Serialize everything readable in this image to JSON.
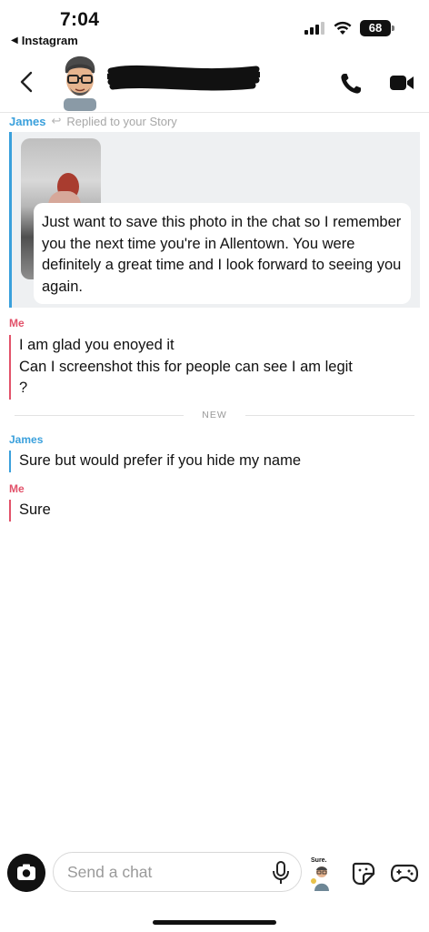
{
  "status_bar": {
    "time": "7:04",
    "back_app": "Instagram",
    "battery": "68"
  },
  "header": {
    "back": "back-chevron-icon",
    "avatar": "bitmoji-avatar",
    "contact_name": "",
    "call": "phone-icon",
    "video": "video-camera-icon"
  },
  "story_reply": {
    "sender": "James",
    "reply_label": "Replied to your Story",
    "caption": "Just want to save this photo in the chat so I remember you the next time you're in Allentown. You were definitely a great time and I look forward to seeing you again."
  },
  "messages": [
    {
      "sender": "Me",
      "lines": [
        "I am glad you enoyed it",
        "Can I screenshot this for people can see I am legit",
        "?"
      ]
    },
    {
      "sender": "James",
      "lines": [
        "Sure but would prefer if you hide my name"
      ]
    },
    {
      "sender": "Me",
      "lines": [
        "Sure"
      ]
    }
  ],
  "divider": {
    "label": "NEW"
  },
  "composer": {
    "placeholder": "Send a chat",
    "bitmoji_caption": "Sure.",
    "icons": [
      "camera-icon",
      "microphone-icon",
      "bitmoji-sticker",
      "sticker-icon",
      "game-controller-icon"
    ]
  },
  "colors": {
    "james": "#3aa0dc",
    "me": "#e2526a",
    "background": "#ffffff",
    "story_bg": "#eef0f2"
  }
}
